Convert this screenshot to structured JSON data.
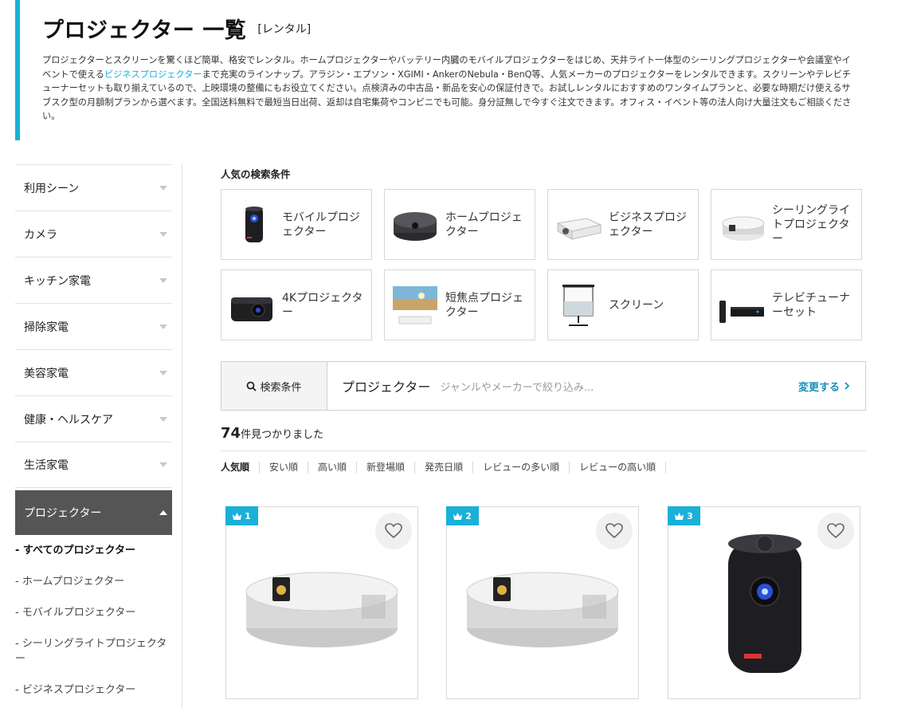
{
  "header": {
    "title": "プロジェクター 一覧",
    "badge": "[レンタル]",
    "desc_part1": "プロジェクターとスクリーンを驚くほど簡単、格安でレンタル。ホームプロジェクターやバッテリー内臓のモバイルプロジェクターをはじめ、天井ライト一体型のシーリングプロジェクターや会議室やイベントで使える",
    "desc_highlight": "ビジネスプロジェクター",
    "desc_part2": "まで充実のラインナップ。アラジン・エプソン・XGIMI・AnkerのNebula・BenQ等、人気メーカーのプロジェクターをレンタルできます。スクリーンやテレビチューナーセットも取り揃えているので、上映環境の整備にもお役立てください。点検済みの中古品・新品を安心の保証付きで。お試しレンタルにおすすめのワンタイムプランと、必要な時期だけ使えるサブスク型の月額制プランから選べます。全国送料無料で最短当日出荷、返却は自宅集荷やコンビニでも可能。身分証無しで今すぐ注文できます。オフィス・イベント等の法人向け大量注文もご相談ください。"
  },
  "sidebar": {
    "categories": [
      {
        "label": "利用シーン"
      },
      {
        "label": "カメラ"
      },
      {
        "label": "キッチン家電"
      },
      {
        "label": "掃除家電"
      },
      {
        "label": "美容家電"
      },
      {
        "label": "健康・ヘルスケア"
      },
      {
        "label": "生活家電"
      }
    ],
    "active_category": "プロジェクター",
    "subcategories": [
      "- すべてのプロジェクター",
      "- ホームプロジェクター",
      "- モバイルプロジェクター",
      "- シーリングライトプロジェクター",
      "- ビジネスプロジェクター"
    ]
  },
  "popular": {
    "title": "人気の検索条件",
    "tiles": [
      {
        "label": "モバイルプロジェクター",
        "icon": "mobile-projector-icon"
      },
      {
        "label": "ホームプロジェクター",
        "icon": "home-projector-icon"
      },
      {
        "label": "ビジネスプロジェクター",
        "icon": "business-projector-icon"
      },
      {
        "label": "シーリングライトプロジェクター",
        "icon": "ceiling-projector-icon"
      },
      {
        "label": "4Kプロジェクター",
        "icon": "4k-projector-icon"
      },
      {
        "label": "短焦点プロジェクター",
        "icon": "short-throw-projector-icon"
      },
      {
        "label": "スクリーン",
        "icon": "screen-icon"
      },
      {
        "label": "テレビチューナーセット",
        "icon": "tv-tuner-icon"
      }
    ]
  },
  "search": {
    "label": "検索条件",
    "query": "プロジェクター",
    "placeholder": "ジャンルやメーカーで絞り込み...",
    "change": "変更する"
  },
  "results": {
    "count": "74",
    "count_suffix": "件見つかりました"
  },
  "sort": [
    "人気順",
    "安い順",
    "高い順",
    "新登場順",
    "発売日順",
    "レビューの多い順",
    "レビューの高い順"
  ],
  "products": [
    {
      "rank": "1",
      "icon": "ceiling-projector-product"
    },
    {
      "rank": "2",
      "icon": "ceiling-projector-product"
    },
    {
      "rank": "3",
      "icon": "mobile-projector-product"
    }
  ],
  "colors": {
    "accent": "#1ab0d8",
    "link": "#1a8fb8",
    "active_bg": "#555555"
  }
}
